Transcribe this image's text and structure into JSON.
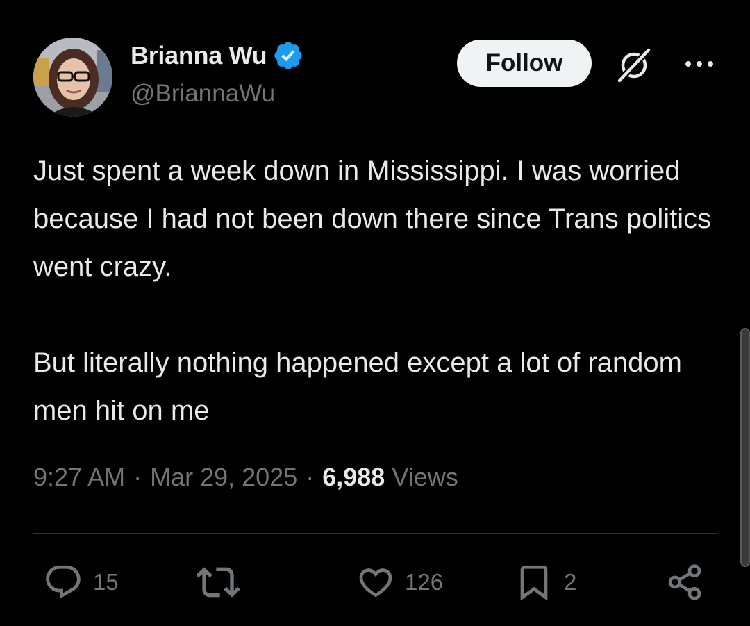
{
  "author": {
    "display_name": "Brianna Wu",
    "handle": "@BriannaWu",
    "verified": true,
    "avatar_icon": "profile-photo"
  },
  "header": {
    "follow_label": "Follow",
    "grok_icon": "grok-icon",
    "more_icon": "more-horizontal-icon"
  },
  "tweet": {
    "paragraphs": [
      "Just spent a week down in Mississippi. I was worried because I had not been down there since Trans politics went crazy.",
      "But literally nothing happened except a lot of random men hit on me"
    ]
  },
  "meta": {
    "time": "9:27 AM",
    "separator": "·",
    "date": "Mar 29, 2025",
    "views_count": "6,988",
    "views_label": "Views"
  },
  "actions": {
    "reply_count": "15",
    "retweet_count": "",
    "like_count": "126",
    "bookmark_count": "2"
  },
  "colors": {
    "background": "#000000",
    "text_primary": "#e7e9ea",
    "text_secondary": "#71767b",
    "verified_blue": "#1d9bf0",
    "follow_bg": "#eff3f4",
    "divider": "#2f3336"
  }
}
